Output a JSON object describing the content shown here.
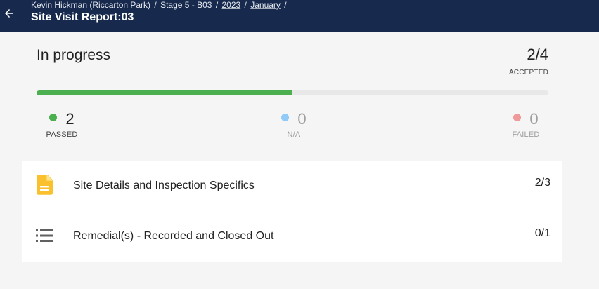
{
  "header": {
    "breadcrumbs": [
      "Kevin Hickman (Riccarton Park)",
      "Stage 5 - B03",
      "2023",
      "January"
    ],
    "separator": "/",
    "title": "Site Visit Report:03",
    "back_icon": "arrow-left-icon"
  },
  "progress": {
    "status": "In progress",
    "count": "2/4",
    "count_label": "ACCEPTED",
    "fill_fraction": 0.5,
    "fill_color": "#4caf50"
  },
  "stats": {
    "passed": {
      "value": "2",
      "label": "PASSED",
      "dot_color": "#4caf50"
    },
    "na": {
      "value": "0",
      "label": "N/A",
      "dot_color": "#90caf9"
    },
    "failed": {
      "value": "0",
      "label": "FAILED",
      "dot_color": "#ef9a9a"
    }
  },
  "sections": [
    {
      "label": "Site Details and Inspection Specifics",
      "progress": "2/3",
      "icon": "document-icon",
      "icon_color": "#fbc02d"
    },
    {
      "label": "Remedial(s) - Recorded and Closed Out",
      "progress": "0/1",
      "icon": "list-icon",
      "icon_color": "#616161"
    }
  ]
}
